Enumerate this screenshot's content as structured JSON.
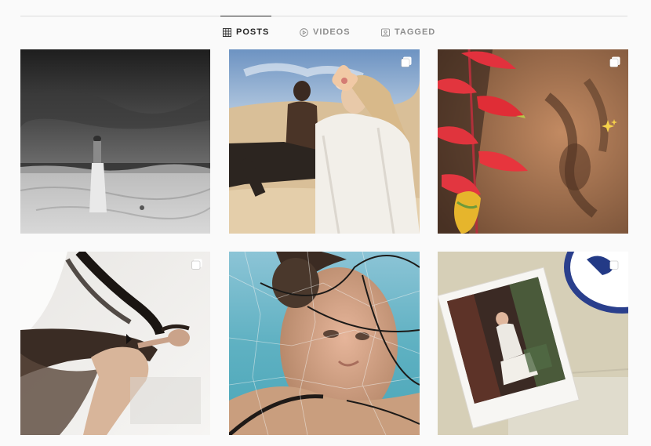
{
  "tabs": [
    {
      "label": "POSTS",
      "icon": "grid-icon",
      "active": true
    },
    {
      "label": "VIDEOS",
      "icon": "play-circle-icon",
      "active": false
    },
    {
      "label": "TAGGED",
      "icon": "tag-portrait-icon",
      "active": false
    }
  ],
  "posts": [
    {
      "id": "beach-bw",
      "multi": false
    },
    {
      "id": "desert-couple",
      "multi": true
    },
    {
      "id": "heliconia-shadow",
      "multi": true,
      "sparkle": true
    },
    {
      "id": "veil-figure",
      "multi": true
    },
    {
      "id": "glass-face",
      "multi": false
    },
    {
      "id": "polaroid",
      "multi": true
    }
  ],
  "colors": {
    "background": "#fafafa",
    "divider": "#dbdbdb",
    "active_tab": "#262626",
    "inactive_tab": "#8e8e8e"
  }
}
